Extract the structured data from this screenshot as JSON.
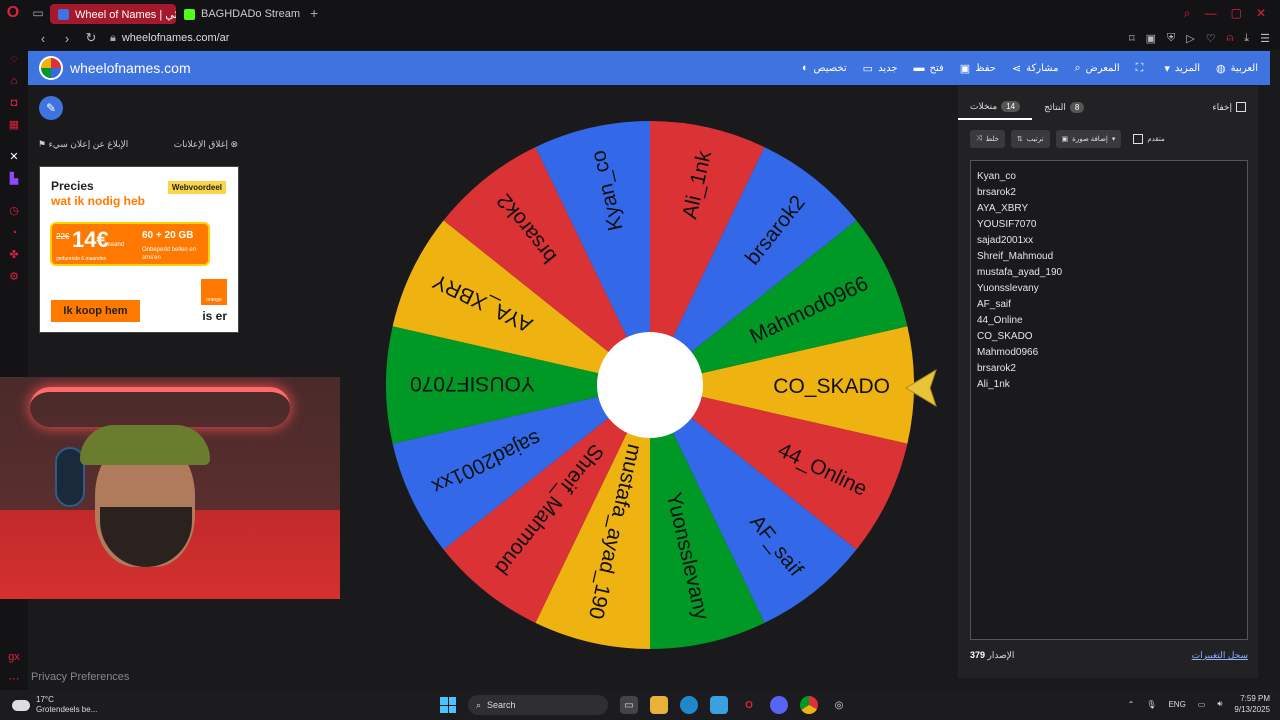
{
  "browser": {
    "tabs": [
      {
        "label": "Wheel of Names | عشوائي",
        "active": true,
        "favicon_color": "#3f73e0"
      },
      {
        "label": "BAGHDADo Stream - Wat",
        "active": false,
        "favicon_color": "#53fc18"
      }
    ],
    "url": "wheelofnames.com/ar"
  },
  "header": {
    "site_name": "wheelofnames.com",
    "menu": [
      {
        "label": "تخصيص",
        "icon": "palette-icon",
        "glyph": "◐"
      },
      {
        "label": "جديد",
        "icon": "new-file-icon",
        "glyph": "▭"
      },
      {
        "label": "فتح",
        "icon": "folder-icon",
        "glyph": "▬"
      },
      {
        "label": "حفظ",
        "icon": "save-icon",
        "glyph": "▣"
      },
      {
        "label": "مشاركة",
        "icon": "share-icon",
        "glyph": "⋖"
      },
      {
        "label": "المعرض",
        "icon": "search-icon",
        "glyph": "⌕"
      },
      {
        "label": "",
        "icon": "fullscreen-icon",
        "glyph": "⛶"
      },
      {
        "label": "المزيد",
        "icon": "chevron-down-icon",
        "glyph": "▾"
      },
      {
        "label": "العربية",
        "icon": "globe-icon",
        "glyph": "◍"
      }
    ]
  },
  "ads": {
    "report_label": "الإبلاغ عن إعلان سيء",
    "close_label": "إغلاق الإعلانات",
    "title": "Precies",
    "subtitle": "wat ik nodig heb",
    "badge": "Webvoordeel",
    "old_price": "22€",
    "price": "14€",
    "per_month": "/maand",
    "duration_note": "gedurende 6 maanden",
    "data": "60 + 20 GB",
    "calls": "Onbeperkt bellen en sms'en",
    "buy_label": "Ik koop hem",
    "brand": "orange",
    "tagline": "is er"
  },
  "privacy": "Privacy Preferences",
  "wheel": {
    "colors": [
      "#db3236",
      "#3369e8",
      "#009925",
      "#eeb211"
    ],
    "segments": [
      "CO_SKADO",
      "44_Online",
      "AF_saif",
      "Yuonsslevany",
      "mustafa_ayad_190",
      "Shreif_Mahmoud",
      "sajad2001xx",
      "YOUSIF7070",
      "AYA_XBRY",
      "brsarok2",
      "Kyan_co",
      "Ali_1nk",
      "brsarok2",
      "Mahmod0966"
    ],
    "segment_colors": [
      "#eeb211",
      "#db3236",
      "#3369e8",
      "#009925",
      "#eeb211",
      "#db3236",
      "#3369e8",
      "#009925",
      "#eeb211",
      "#db3236",
      "#3369e8",
      "#db3236",
      "#3369e8",
      "#009925"
    ]
  },
  "panel": {
    "tab_entries": "منخلات",
    "entries_count": "14",
    "tab_results": "النتائج",
    "results_count": "8",
    "hide_label": "إخفاء",
    "shuffle_label": "خلط",
    "sort_label": "ترتيب",
    "add_image_label": "إضافة صورة",
    "advanced_label": "متقدم",
    "entries": [
      "Kyan_co",
      "brsarok2",
      "AYA_XBRY",
      "YOUSIF7070",
      "sajad2001xx",
      "Shreif_Mahmoud",
      "mustafa_ayad_190",
      "Yuonsslevany",
      "AF_saif",
      "44_Online",
      "CO_SKADO",
      "Mahmod0966",
      "brsarok2",
      "Ali_1nk"
    ],
    "version_label": "الإصدار",
    "version": "379",
    "changelog_label": "سجل التغييرات"
  },
  "taskbar": {
    "temp": "17°C",
    "weather": "Grotendeels be...",
    "search": "Search",
    "lang": "ENG",
    "time": "7:59 PM",
    "date": "9/13/2025"
  }
}
